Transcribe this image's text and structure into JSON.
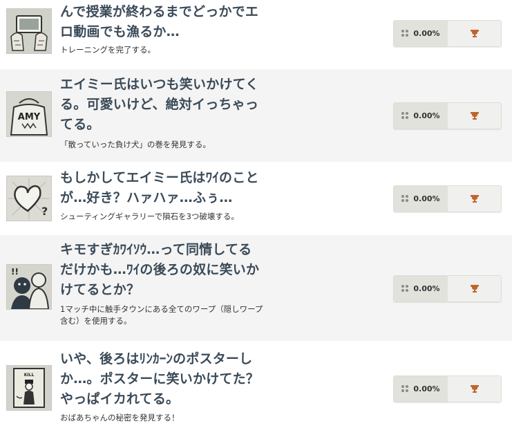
{
  "accent_color": "#c0642a",
  "achievements": [
    {
      "title": "んで授業が終わるまでどっかでエロ動画でも漁るか…",
      "desc": "トレーニングを完了する。",
      "percent": "0.00%",
      "icon": "phone-hands-icon"
    },
    {
      "title": "エイミー氏はいつも笑いかけてくる。可愛いけど、絶対イっちゃってる。",
      "desc": "「散っていった負け犬」の巻を発見する。",
      "percent": "0.00%",
      "icon": "amy-bag-icon"
    },
    {
      "title": "もしかしてエイミー氏はﾜｲのことが…好き？ハァハァ…ふぅ…",
      "desc": "シューティングギャラリーで隕石を3つ破壊する。",
      "percent": "0.00%",
      "icon": "heart-question-icon"
    },
    {
      "title": "キモすぎｶﾜｲｿｳ…って同情してるだけかも…ﾜｲの後ろの奴に笑いかけてるとか？",
      "desc": "1マッチ中に触手タウンにある全てのワープ（隠しワープ含む）を使用する。",
      "percent": "0.00%",
      "icon": "shadow-figure-icon"
    },
    {
      "title": "いや、後ろはﾘﾝｶｰﾝのポスターしか…。ポスターに笑いかけてた？やっぱイカれてる。",
      "desc": "おばあちゃんの秘密を発見する！",
      "percent": "0.00%",
      "icon": "kill-poster-icon"
    }
  ]
}
